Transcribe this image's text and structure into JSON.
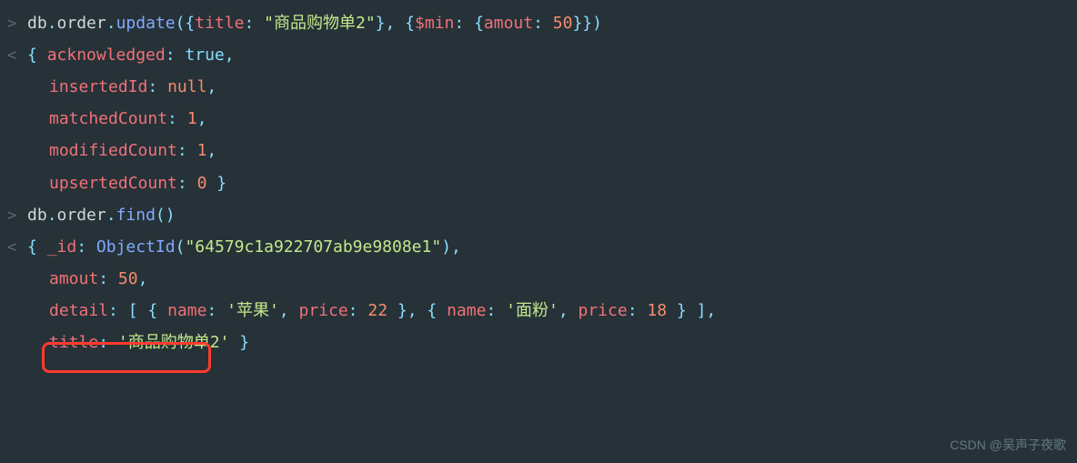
{
  "line1": {
    "prompt": ">",
    "parts": [
      "db",
      ".",
      "order",
      ".",
      "update",
      "({",
      "title",
      ": ",
      "\"商品购物单2\"",
      "}, {",
      "$min",
      ": {",
      "amout",
      ": ",
      "50",
      "}})"
    ]
  },
  "line2": {
    "prompt": "<",
    "parts": [
      "{ ",
      "acknowledged",
      ": ",
      "true",
      ","
    ]
  },
  "line3": {
    "parts": [
      "insertedId",
      ": ",
      "null",
      ","
    ]
  },
  "line4": {
    "parts": [
      "matchedCount",
      ": ",
      "1",
      ","
    ]
  },
  "line5": {
    "parts": [
      "modifiedCount",
      ": ",
      "1",
      ","
    ]
  },
  "line6": {
    "parts": [
      "upsertedCount",
      ": ",
      "0",
      " }"
    ]
  },
  "line7": {
    "prompt": ">",
    "parts": [
      "db",
      ".",
      "order",
      ".",
      "find",
      "()"
    ]
  },
  "line8": {
    "prompt": "<",
    "parts": [
      "{ ",
      "_id",
      ": ",
      "ObjectId",
      "(",
      "\"64579c1a922707ab9e9808e1\"",
      "),"
    ]
  },
  "line9": {
    "parts": [
      "amout",
      ": ",
      "50",
      ","
    ]
  },
  "line10": {
    "parts": [
      "detail",
      ": [ { ",
      "name",
      ": ",
      "'苹果'",
      ", ",
      "price",
      ": ",
      "22",
      " }, { ",
      "name",
      ": ",
      "'面粉'",
      ", ",
      "price",
      ": ",
      "18",
      " } ],"
    ]
  },
  "line11": {
    "parts": [
      "title",
      ": ",
      "'商品购物单2'",
      " }"
    ]
  },
  "watermark": "CSDN @吴声子夜歌"
}
